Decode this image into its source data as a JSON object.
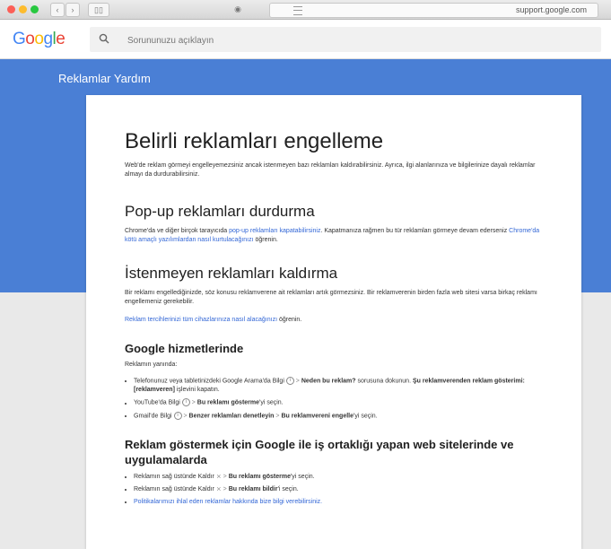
{
  "browser": {
    "url": "support.google.com"
  },
  "header": {
    "search_placeholder": "Sorununuzu açıklayın"
  },
  "band": {
    "title": "Reklamlar Yardım"
  },
  "article": {
    "title": "Belirli reklamları engelleme",
    "intro": "Web'de reklam görmeyi engelleyemezsiniz ancak istenmeyen bazı reklamları kaldırabilirsiniz. Ayrıca, ilgi alanlarınıza ve bilgilerinize dayalı reklamlar almayı da durdurabilirsiniz.",
    "popup": {
      "title": "Pop-up reklamları durdurma",
      "text_before": "Chrome'da ve diğer birçok tarayıcıda ",
      "link1": "pop-up reklamları kapatabilirsiniz",
      "text_middle": ". Kapatmanıza rağmen bu tür reklamları görmeye devam ederseniz ",
      "link2": "Chrome'da kötü amaçlı yazılımlardan nasıl kurtulacağınızı",
      "text_after": " öğrenin."
    },
    "remove": {
      "title": "İstenmeyen reklamları kaldırma",
      "text": "Bir reklamı engellediğinizde, söz konusu reklamverene ait reklamları artık görmezsiniz. Bir reklamverenin birden fazla web sitesi varsa birkaç reklamı engellemeniz gerekebilir.",
      "link": "Reklam tercihlerinizi tüm cihazlarınıza nasıl alacağınızı",
      "link_after": " öğrenin."
    },
    "google": {
      "title": "Google hizmetlerinde",
      "label": "Reklamın yanında:",
      "item1": {
        "a": "Telefonunuz veya tabletinizdeki Google Arama'da Bilgi",
        "b": "Neden bu reklam?",
        "c": " sorusuna dokunun. ",
        "d": "Şu reklamverenden reklam gösterimi: [reklamveren]",
        "e": " işlevini kapatın."
      },
      "item2": {
        "a": "YouTube'da Bilgi",
        "b": "Bu reklamı gösterme",
        "c": "'yi seçin."
      },
      "item3": {
        "a": "Gmail'de Bilgi",
        "b": "Benzer reklamları denetleyin",
        "c": "Bu reklamvereni engelle",
        "d": "'yi seçin."
      }
    },
    "partners": {
      "title": "Reklam göstermek için Google ile iş ortaklığı yapan web sitelerinde ve uygulamalarda",
      "item1": {
        "a": "Reklamın sağ üstünde Kaldır",
        "b": "Bu reklamı gösterme",
        "c": "'yi seçin."
      },
      "item2": {
        "a": "Reklamın sağ üstünde Kaldır",
        "b": "Bu reklamı bildir",
        "c": "'i seçin."
      },
      "item3": {
        "link": "Politikalarımızı ihlal eden reklamlar hakkında bize bilgi verebilirsiniz."
      }
    }
  }
}
